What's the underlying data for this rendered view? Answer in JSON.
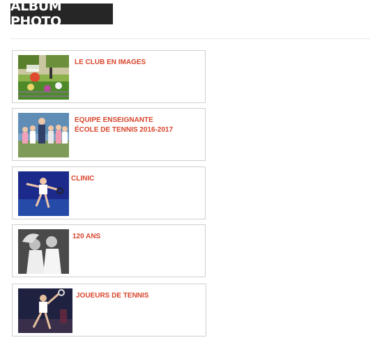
{
  "header": {
    "title": "ALBUM PHOTO"
  },
  "albums": [
    {
      "label": "LE CLUB EN IMAGES"
    },
    {
      "label_line1": "EQUIPE ENSEIGNANTE",
      "label_line2": "ÉCOLE DE TENNIS 2016-2017"
    },
    {
      "label": "CLINIC"
    },
    {
      "label": "120 ANS"
    },
    {
      "label": "JOUEURS DE TENNIS"
    }
  ],
  "colors": {
    "accent": "#d9452c",
    "banner": "#262626",
    "border": "#cfcfcf"
  }
}
